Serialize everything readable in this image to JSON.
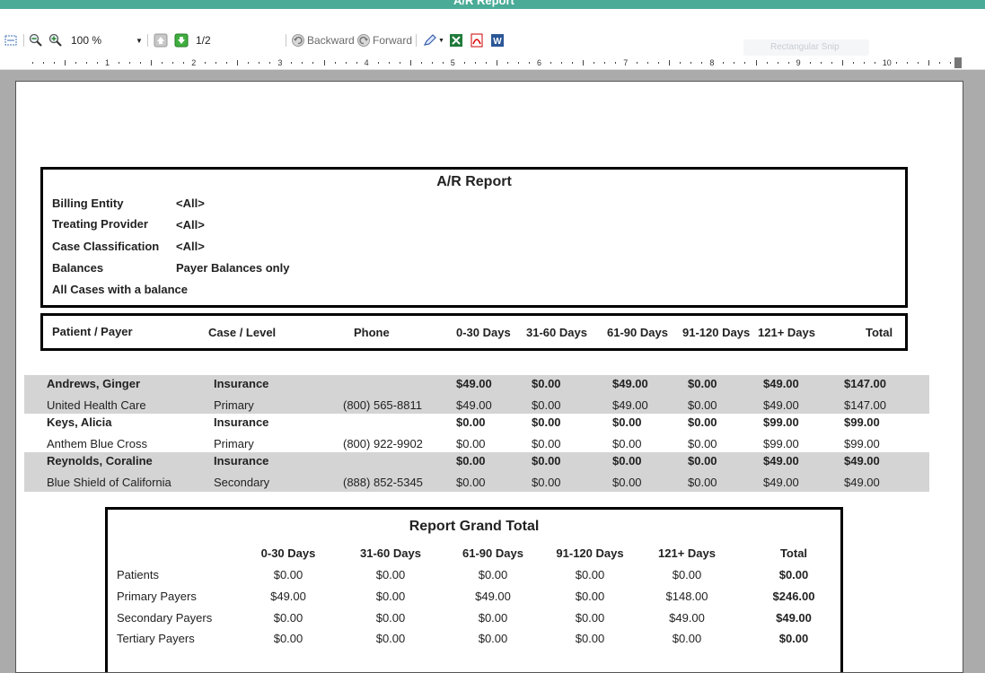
{
  "window": {
    "title": "A/R Report"
  },
  "toolbar": {
    "zoom": "100 %",
    "page": "1/2",
    "backward": "Backward",
    "forward": "Forward",
    "ghost": "Rectangular Snip"
  },
  "ruler": {
    "numbers": [
      "1",
      "2",
      "3",
      "4",
      "5",
      "6",
      "7",
      "8",
      "9",
      "10"
    ]
  },
  "report": {
    "title": "A/R Report",
    "params": [
      {
        "label": "Billing Entity",
        "value": "<All>"
      },
      {
        "label": "Treating Provider",
        "value": "<All>"
      },
      {
        "label": "Case Classification",
        "value": "<All>"
      },
      {
        "label": "Balances",
        "value": "Payer Balances only"
      },
      {
        "label": "All Cases with a balance",
        "value": ""
      }
    ],
    "columns": [
      "Patient / Payer",
      "Case / Level",
      "Phone",
      "0-30 Days",
      "31-60 Days",
      "61-90 Days",
      "91-120 Days",
      "121+ Days",
      "Total"
    ],
    "rows": [
      {
        "name": "Andrews, Ginger",
        "level": "Insurance",
        "phone": "",
        "d0": "$49.00",
        "d31": "$0.00",
        "d61": "$49.00",
        "d91": "$0.00",
        "d121": "$49.00",
        "total": "$147.00"
      },
      {
        "name": "United Health Care",
        "level": "Primary",
        "phone": "(800) 565-8811",
        "d0": "$49.00",
        "d31": "$0.00",
        "d61": "$49.00",
        "d91": "$0.00",
        "d121": "$49.00",
        "total": "$147.00"
      },
      {
        "name": "Keys, Alicia",
        "level": "Insurance",
        "phone": "",
        "d0": "$0.00",
        "d31": "$0.00",
        "d61": "$0.00",
        "d91": "$0.00",
        "d121": "$99.00",
        "total": "$99.00"
      },
      {
        "name": "Anthem Blue Cross",
        "level": "Primary",
        "phone": "(800) 922-9902",
        "d0": "$0.00",
        "d31": "$0.00",
        "d61": "$0.00",
        "d91": "$0.00",
        "d121": "$99.00",
        "total": "$99.00"
      },
      {
        "name": "Reynolds, Coraline",
        "level": "Insurance",
        "phone": "",
        "d0": "$0.00",
        "d31": "$0.00",
        "d61": "$0.00",
        "d91": "$0.00",
        "d121": "$49.00",
        "total": "$49.00"
      },
      {
        "name": "Blue Shield of California",
        "level": "Secondary",
        "phone": "(888) 852-5345",
        "d0": "$0.00",
        "d31": "$0.00",
        "d61": "$0.00",
        "d91": "$0.00",
        "d121": "$49.00",
        "total": "$49.00"
      }
    ],
    "grand_total": {
      "title": "Report Grand Total",
      "columns": [
        "0-30 Days",
        "31-60 Days",
        "61-90 Days",
        "91-120 Days",
        "121+ Days",
        "Total"
      ],
      "rows": [
        {
          "label": "Patients",
          "values": [
            "$0.00",
            "$0.00",
            "$0.00",
            "$0.00",
            "$0.00",
            "$0.00"
          ]
        },
        {
          "label": "Primary Payers",
          "values": [
            "$49.00",
            "$0.00",
            "$49.00",
            "$0.00",
            "$148.00",
            "$246.00"
          ]
        },
        {
          "label": "Secondary Payers",
          "values": [
            "$0.00",
            "$0.00",
            "$0.00",
            "$0.00",
            "$49.00",
            "$49.00"
          ]
        },
        {
          "label": "Tertiary Payers",
          "values": [
            "$0.00",
            "$0.00",
            "$0.00",
            "$0.00",
            "$0.00",
            "$0.00"
          ]
        }
      ]
    }
  },
  "colors": {
    "titlebar": "#4aab97",
    "shade": "#d4d4d4"
  },
  "icons": [
    "page-setup-icon",
    "zoom-out-icon",
    "zoom-in-icon",
    "first-page-icon",
    "next-page-icon",
    "backward-icon",
    "forward-icon",
    "edit-icon",
    "excel-icon",
    "pdf-icon",
    "word-icon"
  ]
}
